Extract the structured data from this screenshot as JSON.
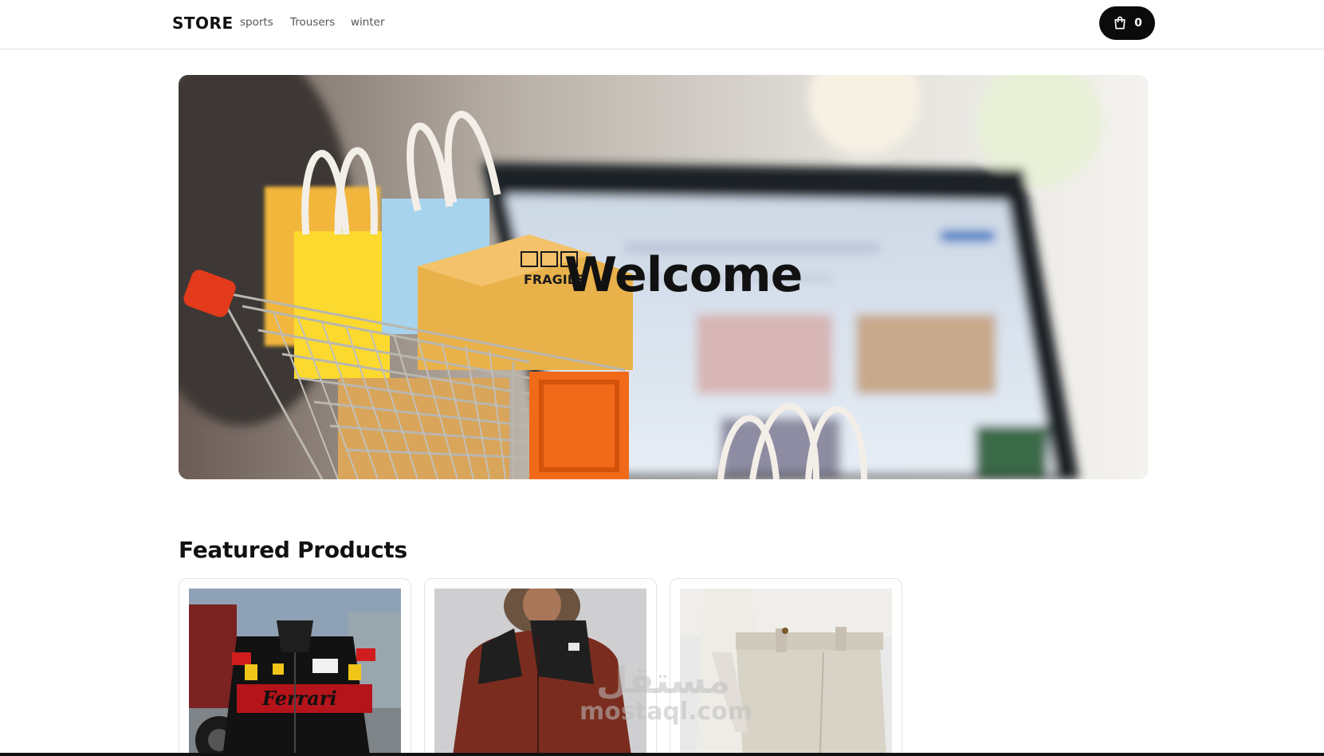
{
  "navbar": {
    "brand": "STORE",
    "links": [
      "sports",
      "Trousers",
      "winter"
    ],
    "cart_icon": "shopping-bag-icon",
    "cart_count": "0"
  },
  "hero": {
    "title": "Welcome",
    "image_text": "FRAGILE"
  },
  "featured": {
    "title": "Featured Products",
    "products": [
      {
        "image": "ferrari-racing-jacket",
        "image_text": "Ferrari"
      },
      {
        "image": "red-winter-parka"
      },
      {
        "image": "beige-trousers"
      }
    ]
  },
  "watermark": {
    "arabic": "مستقل",
    "latin": "mostaql.com"
  },
  "colors": {
    "accent": "#0b0b0b",
    "background": "#ffffff",
    "border": "#e3e3e3"
  }
}
